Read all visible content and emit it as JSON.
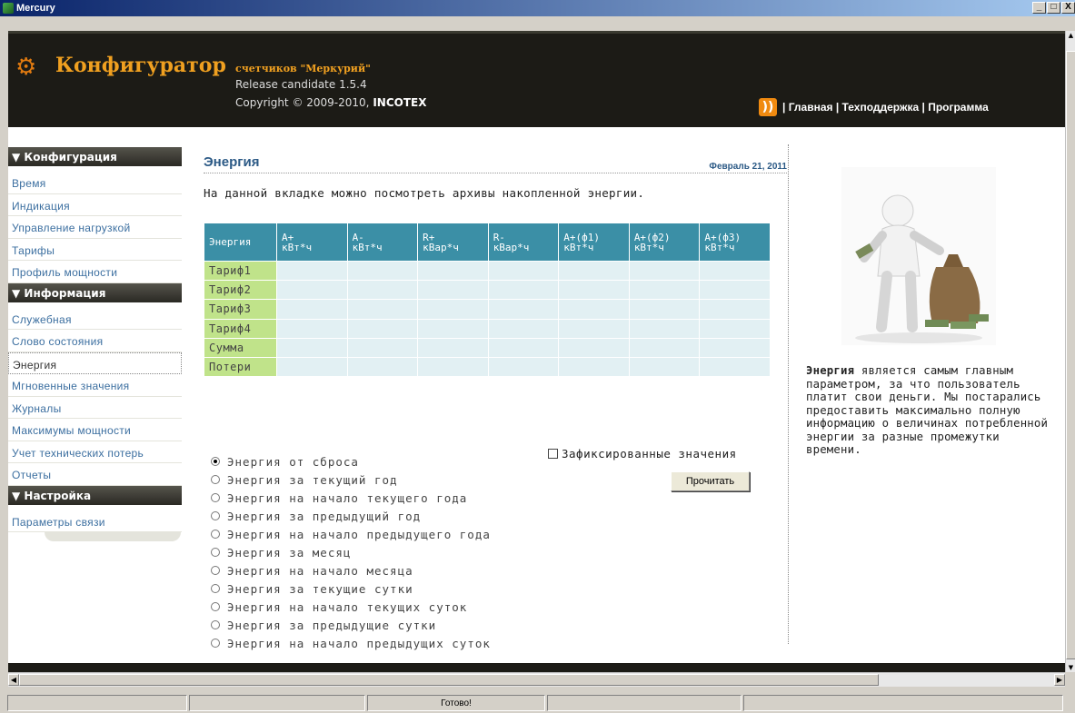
{
  "window": {
    "title": "Mercury",
    "buttons": [
      "_",
      "□",
      "X"
    ]
  },
  "header": {
    "title": "Конфигуратор",
    "subtitle": "счетчиков \"Меркурий\"",
    "release": "Release candidate 1.5.4",
    "copyright_prefix": "Copyright © 2009-2010, ",
    "copyright_company": "INCOTEX",
    "nav": {
      "sep1": " | ",
      "home": "Главная",
      "sep2": " | ",
      "support": "Техподдержка",
      "sep3": " | ",
      "program": "Программа"
    }
  },
  "sidebar": {
    "sections": [
      {
        "title": "▼ Конфигурация",
        "items": [
          "Время",
          "Индикация",
          "Управление нагрузкой",
          "Тарифы",
          "Профиль мощности"
        ]
      },
      {
        "title": "▼ Информация",
        "items": [
          "Служебная",
          "Слово состояния",
          "Энергия",
          "Мгновенные значения",
          "Журналы",
          "Максимумы мощности",
          "Учет технических потерь",
          "Отчеты"
        ]
      },
      {
        "title": "▼ Настройка",
        "items": [
          "Параметры связи"
        ]
      }
    ],
    "active": "Энергия"
  },
  "page": {
    "title": "Энергия",
    "date": "Февраль 21, 2011",
    "description": "На данной вкладке можно посмотреть архивы накопленной энергии."
  },
  "table": {
    "headers": [
      {
        "l1": "Энергия",
        "l2": ""
      },
      {
        "l1": "A+",
        "l2": "кВт*ч"
      },
      {
        "l1": "A-",
        "l2": "кВт*ч"
      },
      {
        "l1": "R+",
        "l2": "кВар*ч"
      },
      {
        "l1": "R-",
        "l2": "кВар*ч"
      },
      {
        "l1": "A+(ф1)",
        "l2": "кВт*ч"
      },
      {
        "l1": "A+(ф2)",
        "l2": "кВт*ч"
      },
      {
        "l1": "A+(ф3)",
        "l2": "кВт*ч"
      }
    ],
    "rows": [
      "Тариф1",
      "Тариф2",
      "Тариф3",
      "Тариф4",
      "Сумма",
      "Потери"
    ]
  },
  "options": {
    "items": [
      "Энергия от сброса",
      "Энергия за текущий год",
      "Энергия на начало текущего года",
      "Энергия за предыдущий год",
      "Энергия на начало предыдущего года",
      "Энергия за месяц",
      "Энергия на начало месяца",
      "Энергия за текущие сутки",
      "Энергия на начало текущих суток",
      "Энергия за предыдущие сутки",
      "Энергия на начало предыдущих суток"
    ],
    "selected": 0,
    "fixed_label": "Зафиксированные значения",
    "fixed_checked": false,
    "read_button": "Прочитать"
  },
  "aside": {
    "bold": "Энергия",
    "text": " является самым главным параметром, за что пользователь платит свои деньги. Мы постарались предоставить максимально полную информацию о величинах потребленной энергии за разные промежутки времени."
  },
  "status": {
    "panels": [
      "",
      "",
      "Готово!",
      "",
      ""
    ]
  },
  "colors": {
    "header_bg": "#1c1b16",
    "accent": "#f0a020",
    "table_header": "#3b8fa6",
    "row_label": "#c0e38a",
    "cell": "#e2f0f3",
    "link": "#3c6fa0"
  }
}
